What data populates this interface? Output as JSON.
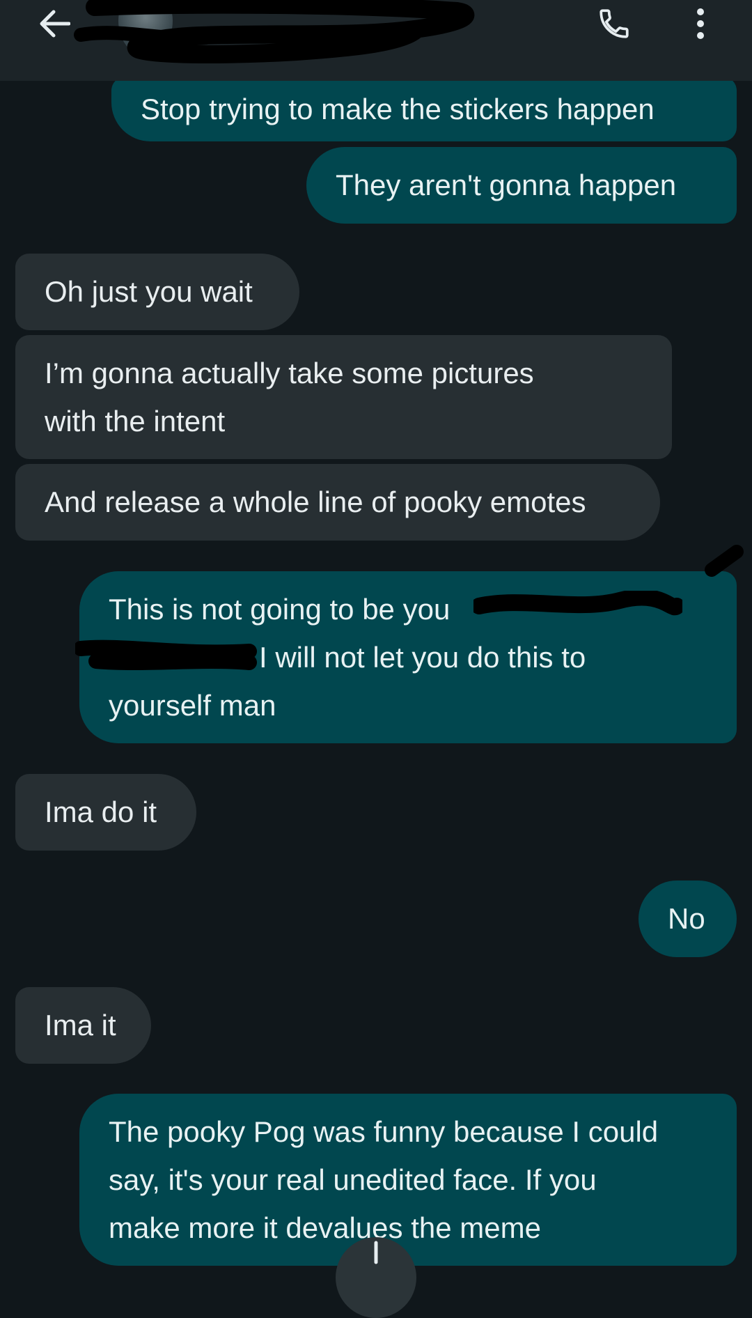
{
  "header": {
    "contact_name": "",
    "back_icon": "arrow-left-icon",
    "call_icon": "phone-icon",
    "more_icon": "more-vert-icon"
  },
  "colors": {
    "outgoing_bubble": "#01474f",
    "incoming_bubble": "#272f33",
    "background": "#10171b",
    "app_bar": "#1c2428"
  },
  "messages": [
    {
      "direction": "outgoing",
      "lines": [
        "Stop trying to make the stickers happen"
      ]
    },
    {
      "direction": "outgoing",
      "lines": [
        "They aren't gonna happen"
      ]
    },
    {
      "direction": "incoming",
      "lines": [
        "Oh just you wait"
      ]
    },
    {
      "direction": "incoming",
      "lines": [
        "I’m gonna actually take some pictures",
        "with the intent"
      ]
    },
    {
      "direction": "incoming",
      "lines": [
        "And release a whole line of pooky emotes"
      ]
    },
    {
      "direction": "outgoing",
      "lines": [
        "This is not going to be you",
        "I will not let you do this to",
        "yourself man"
      ]
    },
    {
      "direction": "incoming",
      "lines": [
        "Ima do it"
      ]
    },
    {
      "direction": "outgoing",
      "lines": [
        "No"
      ]
    },
    {
      "direction": "incoming",
      "lines": [
        "Ima it"
      ]
    },
    {
      "direction": "outgoing",
      "lines": [
        "The pooky Pog was funny because I could",
        "say, it's your real unedited face. If you",
        "make more it devalues the meme"
      ]
    }
  ],
  "scroll_button_icon": "arrow-down-icon"
}
